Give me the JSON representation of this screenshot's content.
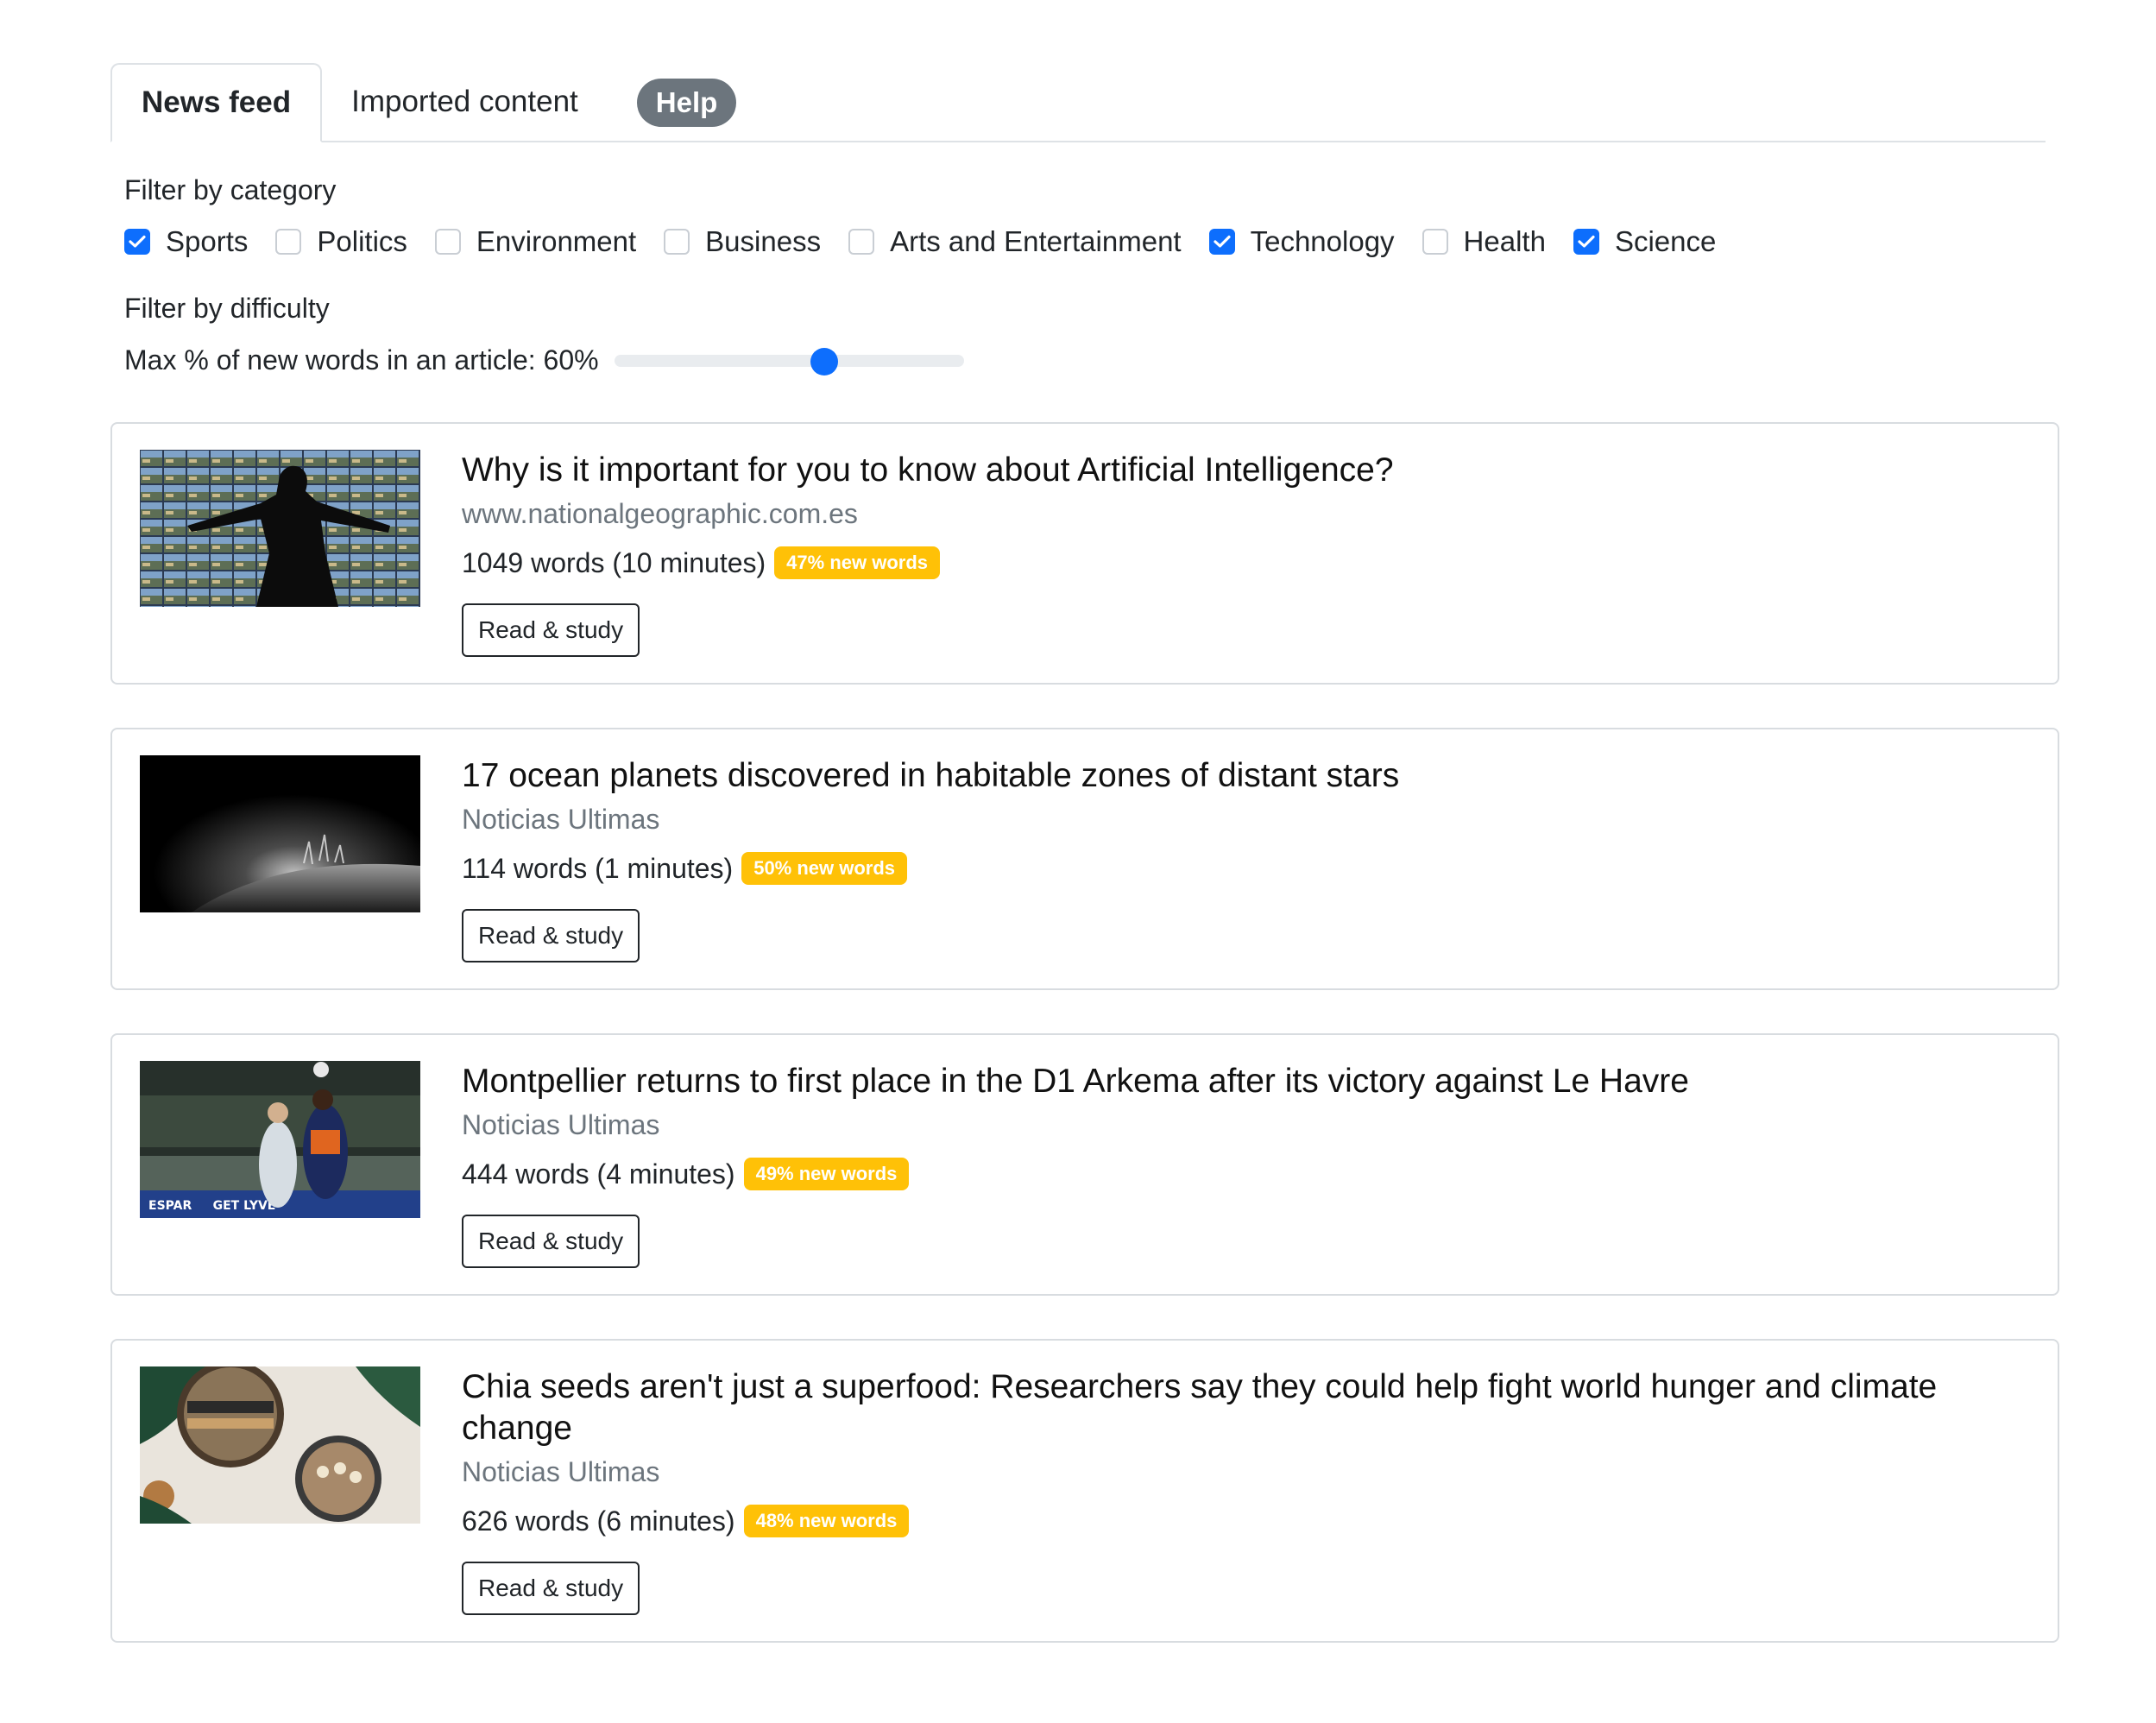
{
  "tabs": {
    "news_feed": "News feed",
    "imported": "Imported content",
    "help": "Help"
  },
  "filters": {
    "category_heading": "Filter by category",
    "categories": [
      {
        "label": "Sports",
        "checked": true
      },
      {
        "label": "Politics",
        "checked": false
      },
      {
        "label": "Environment",
        "checked": false
      },
      {
        "label": "Business",
        "checked": false
      },
      {
        "label": "Arts and Entertainment",
        "checked": false
      },
      {
        "label": "Technology",
        "checked": true
      },
      {
        "label": "Health",
        "checked": false
      },
      {
        "label": "Science",
        "checked": true
      }
    ],
    "difficulty_heading": "Filter by difficulty",
    "difficulty_label": "Max % of new words in an article: 60%",
    "difficulty_value_percent": 60
  },
  "articles": [
    {
      "title": "Why is it important for you to know about Artificial Intelligence?",
      "source": "www.nationalgeographic.com.es",
      "meta": "1049 words (10 minutes)",
      "badge": "47% new words",
      "button": "Read & study",
      "image": "ai-silhouette-screens-image"
    },
    {
      "title": "17 ocean planets discovered in habitable zones of distant stars",
      "source": "Noticias Ultimas",
      "meta": "114 words (1 minutes)",
      "badge": "50% new words",
      "button": "Read & study",
      "image": "planet-plumes-image"
    },
    {
      "title": "Montpellier returns to first place in the D1 Arkema after its victory against Le Havre",
      "source": "Noticias Ultimas",
      "meta": "444 words (4 minutes)",
      "badge": "49% new words",
      "button": "Read & study",
      "image": "soccer-header-image"
    },
    {
      "title": "Chia seeds aren't just a superfood: Researchers say they could help fight world hunger and climate change",
      "source": "Noticias Ultimas",
      "meta": "626 words (6 minutes)",
      "badge": "48% new words",
      "button": "Read & study",
      "image": "chia-bowls-image"
    }
  ],
  "colors": {
    "primary": "#0d6efd",
    "badge": "#ffc107",
    "help_pill": "#6c757d"
  }
}
